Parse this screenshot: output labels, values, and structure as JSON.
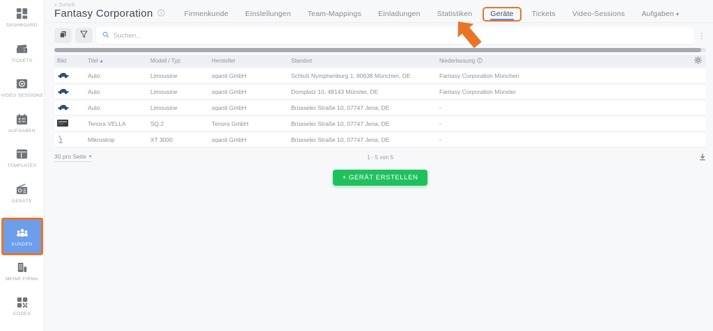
{
  "back_link": "« Zurück",
  "header": {
    "title": "Fantasy Corporation",
    "tabs": [
      {
        "label": "Firmenkunde"
      },
      {
        "label": "Einstellungen"
      },
      {
        "label": "Team-Mappings"
      },
      {
        "label": "Einladungen"
      },
      {
        "label": "Statistiken"
      },
      {
        "label": "Geräte",
        "active": true
      },
      {
        "label": "Tickets"
      },
      {
        "label": "Video-Sessions"
      },
      {
        "label": "Aufgaben"
      }
    ]
  },
  "sidebar": {
    "items": [
      {
        "label": "DASHBOARD",
        "icon": "dashboard-icon"
      },
      {
        "label": "TICKETS",
        "icon": "ticket-icon"
      },
      {
        "label": "VIDEO SESSIONS",
        "icon": "video-session-icon"
      },
      {
        "label": "AUFGABEN",
        "icon": "tasks-calendar-icon"
      },
      {
        "label": "TEMPLATES",
        "icon": "template-window-icon"
      },
      {
        "label": "GERÄTE",
        "icon": "device-radio-icon"
      },
      {
        "label": "KUNDEN",
        "icon": "customers-people-icon",
        "active": true
      },
      {
        "label": "MEINE FIRMA",
        "icon": "company-building-icon"
      },
      {
        "label": "CODES",
        "icon": "qr-code-icon"
      }
    ]
  },
  "toolbar": {
    "search_placeholder": "Suchen..."
  },
  "table": {
    "headers": {
      "bild": "Bild",
      "titel": "Titel",
      "modell": "Modell / Typ",
      "hersteller": "Hersteller",
      "standort": "Standort",
      "niederlassung": "Niederlassung"
    },
    "sort": {
      "column": "Titel",
      "direction": "asc"
    },
    "rows": [
      {
        "image": "car-icon",
        "titel": "Auto",
        "modell": "Limousine",
        "hersteller": "sqanit GmbH",
        "standort": "Schloß Nymphenburg 1, 80638 München, DE",
        "niederlassung": "Fantasy Corporation München"
      },
      {
        "image": "car-icon",
        "titel": "Auto",
        "modell": "Limousine",
        "hersteller": "sqanit GmbH",
        "standort": "Domplatz 10, 48143 Münster, DE",
        "niederlassung": "Fantasy Corporation Münster"
      },
      {
        "image": "car-icon",
        "titel": "Auto",
        "modell": "Limousine",
        "hersteller": "sqanit GmbH",
        "standort": "Brüsseler Straße 10, 07747 Jena, DE",
        "niederlassung": "-"
      },
      {
        "image": "device-photo",
        "titel": "Tenora VELLA",
        "modell": "SQ.2",
        "hersteller": "Tenora GmbH",
        "standort": "Brüsseler Straße 10, 07747 Jena, DE",
        "niederlassung": "-"
      },
      {
        "image": "microscope-icon",
        "titel": "Mikroskop",
        "modell": "XT 3000",
        "hersteller": "sqanit GmbH",
        "standort": "Brüsseler Straße 10, 07747 Jena, DE",
        "niederlassung": "-"
      }
    ]
  },
  "pagination": {
    "page_size_label": "30 pro Seite",
    "range_label": "1 - 5 von 5"
  },
  "actions": {
    "create_device": "+ GERÄT ERSTELLEN"
  },
  "glyphs": {
    "caret_down": "▾",
    "sort_asc": "▲",
    "kebab": "⋮"
  },
  "colors": {
    "annotation_orange": "#e87427",
    "active_tab_underline": "#5b8def",
    "active_sidebar_blue": "#6d9eeb",
    "create_button_green": "#1fc15c"
  }
}
